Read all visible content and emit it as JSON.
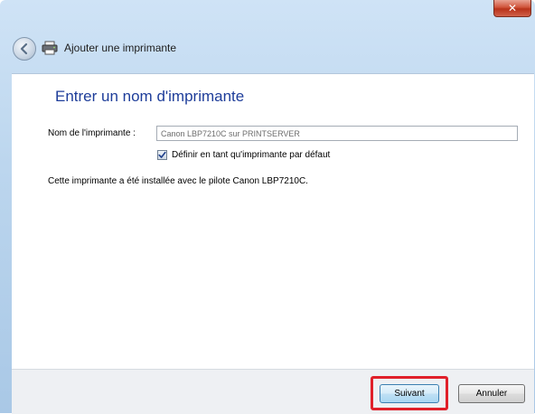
{
  "window": {
    "close_label": "✕",
    "title": "Ajouter une imprimante"
  },
  "icons": {
    "back": "back-arrow-icon",
    "printer": "printer-icon",
    "close": "close-icon",
    "checkmark": "checkmark-icon"
  },
  "main": {
    "heading": "Entrer un nom d'imprimante",
    "name_label": "Nom de l'imprimante :",
    "name_value": "Canon LBP7210C sur PRINTSERVER",
    "default_checkbox_label": "Définir en tant qu'imprimante par défaut",
    "default_checked": true,
    "info": "Cette imprimante a été installée avec le pilote Canon LBP7210C."
  },
  "footer": {
    "next_label": "Suivant",
    "cancel_label": "Annuler"
  },
  "colors": {
    "heading": "#1e3d9a",
    "highlight": "#e0202a",
    "chrome": "#bcd6ee"
  }
}
